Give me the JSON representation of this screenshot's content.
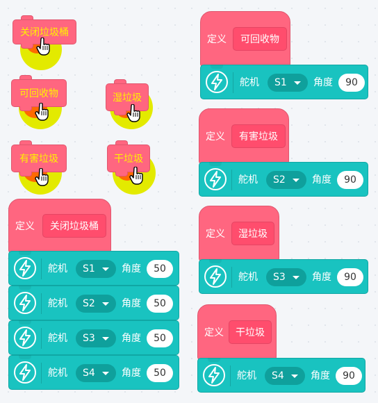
{
  "call_blocks": [
    {
      "label": "关闭垃圾桶"
    },
    {
      "label": "可回收物"
    },
    {
      "label": "湿垃圾"
    },
    {
      "label": "有害垃圾"
    },
    {
      "label": "干垃圾"
    }
  ],
  "define_word": "定义",
  "servo_name": "舵机",
  "angle_label": "角度",
  "definitions": [
    {
      "name": "关闭垃圾桶",
      "servos": [
        {
          "port": "S1",
          "angle": "50"
        },
        {
          "port": "S2",
          "angle": "50"
        },
        {
          "port": "S3",
          "angle": "50"
        },
        {
          "port": "S4",
          "angle": "50"
        }
      ]
    },
    {
      "name": "可回收物",
      "servos": [
        {
          "port": "S1",
          "angle": "90"
        }
      ]
    },
    {
      "name": "有害垃圾",
      "servos": [
        {
          "port": "S2",
          "angle": "90"
        }
      ]
    },
    {
      "name": "湿垃圾",
      "servos": [
        {
          "port": "S3",
          "angle": "90"
        }
      ]
    },
    {
      "name": "干垃圾",
      "servos": [
        {
          "port": "S4",
          "angle": "90"
        }
      ]
    }
  ],
  "icons": {
    "servo": "lightning-bolt-icon",
    "cursor": "hand-pointer-icon",
    "dropdown": "caret-down-icon"
  },
  "colors": {
    "call_block": "#ff6680",
    "servo_block": "#19c3c0",
    "highlight_text": "#fff200",
    "glow": "#e3ea00"
  }
}
